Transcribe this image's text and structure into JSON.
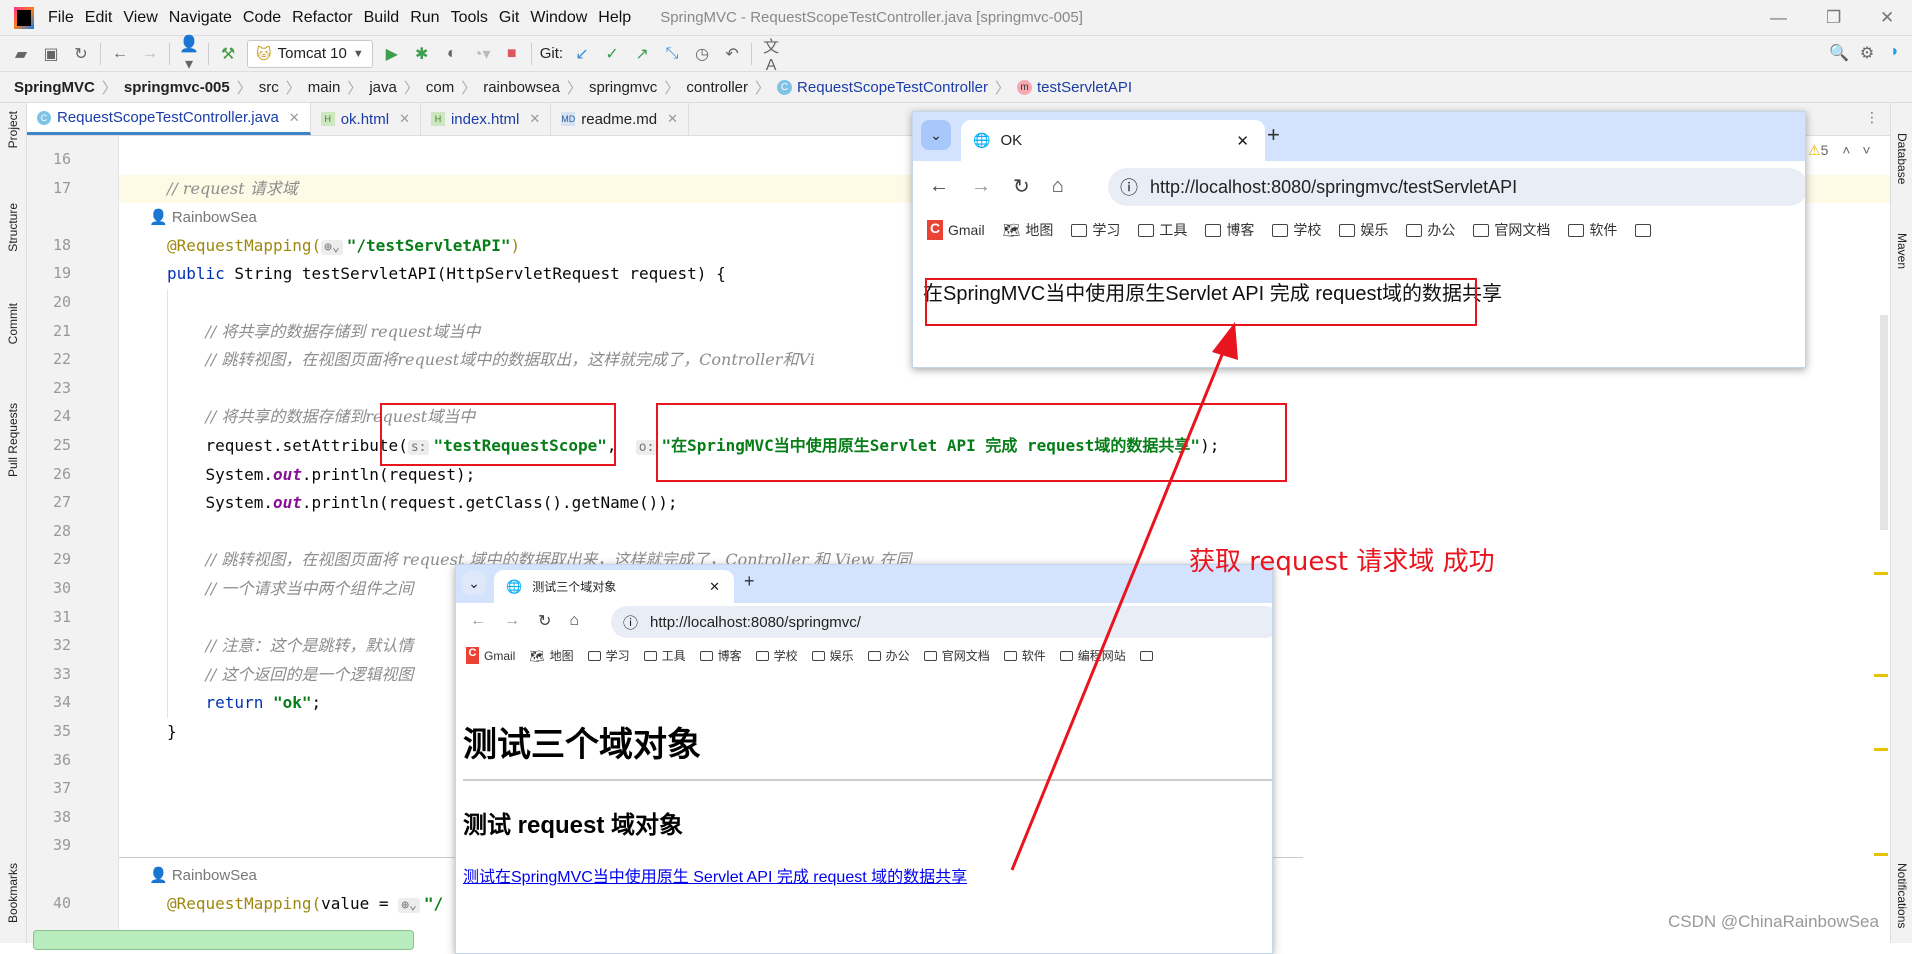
{
  "window": {
    "title": "SpringMVC - RequestScopeTestController.java [springmvc-005]",
    "menu": [
      "File",
      "Edit",
      "View",
      "Navigate",
      "Code",
      "Refactor",
      "Build",
      "Run",
      "Tools",
      "Git",
      "Window",
      "Help"
    ]
  },
  "toolbar": {
    "run_config": "Tomcat 10",
    "git_label": "Git:"
  },
  "breadcrumb": [
    "SpringMVC",
    "springmvc-005",
    "src",
    "main",
    "java",
    "com",
    "rainbowsea",
    "springmvc",
    "controller",
    "RequestScopeTestController",
    "testServletAPI"
  ],
  "tabs": [
    {
      "label": "RequestScopeTestController.java",
      "icon": "class-icon",
      "active": true
    },
    {
      "label": "ok.html",
      "icon": "html-icon"
    },
    {
      "label": "index.html",
      "icon": "html-icon"
    },
    {
      "label": "readme.md",
      "icon": "markdown-icon"
    }
  ],
  "left_tools": [
    "Project",
    "Structure",
    "Commit",
    "Pull Requests",
    "Bookmarks"
  ],
  "right_tools": [
    "Database",
    "Maven",
    "Notifications"
  ],
  "inspections": {
    "warnings": "5"
  },
  "code": [
    {
      "n": "16",
      "t": []
    },
    {
      "n": "17",
      "hl": true,
      "t": [
        [
          "cm",
          "// request 请求域"
        ]
      ]
    },
    {
      "n": "",
      "t": [
        [
          "au",
          "RainbowSea"
        ]
      ],
      "inlay": true
    },
    {
      "n": "18",
      "t": [
        [
          "an",
          "@RequestMapping("
        ],
        [
          "hint",
          "⊕⌄"
        ],
        [
          "str u",
          "\"/testServletAPI\""
        ],
        [
          "",
          "",
          ""
        ],
        [
          "an",
          ")"
        ]
      ]
    },
    {
      "n": "19",
      "t": [
        [
          "kw",
          "public"
        ],
        [
          "",
          " String testServletAPI(HttpServletRequest request) {"
        ]
      ]
    },
    {
      "n": "20",
      "t": []
    },
    {
      "n": "21",
      "t": [
        [
          "",
          "    "
        ],
        [
          "cm",
          "// 将共享的数据存储到 request域当中"
        ]
      ]
    },
    {
      "n": "22",
      "t": [
        [
          "",
          "    "
        ],
        [
          "cm",
          "// 跳转视图，在视图页面将request域中的数据取出，这样就完成了，Controller和Vi"
        ]
      ]
    },
    {
      "n": "23",
      "t": []
    },
    {
      "n": "24",
      "t": [
        [
          "",
          "    "
        ],
        [
          "cm",
          "// 将共享的数据存储到request域当中"
        ]
      ]
    },
    {
      "n": "25",
      "t": [
        [
          "",
          "    request.setAttribute("
        ],
        [
          "hint",
          "s:"
        ],
        [
          "str",
          "\"testRequestScope\""
        ],
        [
          "",
          ",  "
        ],
        [
          "hint",
          "o:"
        ],
        [
          "str",
          "\"在SpringMVC当中使用原生Servlet API 完成 request域的数据共享\""
        ],
        [
          "",
          ");"
        ]
      ]
    },
    {
      "n": "26",
      "t": [
        [
          "",
          "    System."
        ],
        [
          "out",
          "out"
        ],
        [
          "",
          ".println(request);"
        ]
      ]
    },
    {
      "n": "27",
      "t": [
        [
          "",
          "    System."
        ],
        [
          "out",
          "out"
        ],
        [
          "",
          ".println(request.getClass().getName());"
        ]
      ]
    },
    {
      "n": "28",
      "t": []
    },
    {
      "n": "29",
      "t": [
        [
          "",
          "    "
        ],
        [
          "cm",
          "// 跳转视图，在视图页面将 request 域中的数据取出来，这样就完成了，Controller 和 View 在同"
        ]
      ]
    },
    {
      "n": "30",
      "t": [
        [
          "",
          "    "
        ],
        [
          "cm",
          "// 一个请求当中两个组件之间"
        ]
      ]
    },
    {
      "n": "31",
      "t": []
    },
    {
      "n": "32",
      "t": [
        [
          "",
          "    "
        ],
        [
          "cm",
          "// 注意：这个是跳转，默认情"
        ]
      ]
    },
    {
      "n": "33",
      "t": [
        [
          "",
          "    "
        ],
        [
          "cm",
          "// 这个返回的是一个逻辑视图"
        ]
      ]
    },
    {
      "n": "34",
      "t": [
        [
          "",
          "    "
        ],
        [
          "kw",
          "return"
        ],
        [
          "",
          " "
        ],
        [
          "str",
          "\"ok\""
        ],
        [
          "",
          ";"
        ]
      ]
    },
    {
      "n": "35",
      "t": [
        [
          "",
          "}"
        ]
      ]
    },
    {
      "n": "36",
      "t": []
    },
    {
      "n": "37",
      "t": []
    },
    {
      "n": "38",
      "t": []
    },
    {
      "n": "39",
      "t": []
    },
    {
      "n": "",
      "t": [
        [
          "au",
          "RainbowSea"
        ]
      ],
      "inlay": true
    },
    {
      "n": "40",
      "t": [
        [
          "an",
          "@RequestMapping("
        ],
        [
          "",
          "value = "
        ],
        [
          "hint",
          "⊕⌄"
        ],
        [
          "str",
          "\"/"
        ]
      ]
    }
  ],
  "browser_ok": {
    "tab_title": "OK",
    "url": "http://localhost:8080/springmvc/testServletAPI",
    "bookmarks": [
      "Gmail",
      "地图",
      "学习",
      "工具",
      "博客",
      "学校",
      "娱乐",
      "办公",
      "官网文档",
      "软件"
    ],
    "content": "在SpringMVC当中使用原生Servlet API 完成 request域的数据共享"
  },
  "browser_index": {
    "tab_title": "测试三个域对象",
    "url": "http://localhost:8080/springmvc/",
    "bookmarks": [
      "Gmail",
      "地图",
      "学习",
      "工具",
      "博客",
      "学校",
      "娱乐",
      "办公",
      "官网文档",
      "软件",
      "编程网站"
    ],
    "h1": "测试三个域对象",
    "h2": "测试 request 域对象",
    "link": "测试在SpringMVC当中使用原生 Servlet API 完成 request 域的数据共享"
  },
  "annotation": "获取 request 请求域 成功",
  "watermark": "CSDN @ChinaRainbowSea",
  "colors": {
    "annotation_red": "#e8141e",
    "link_blue": "#0000ee",
    "string_green": "#067d17",
    "keyword_blue": "#0033b3"
  }
}
